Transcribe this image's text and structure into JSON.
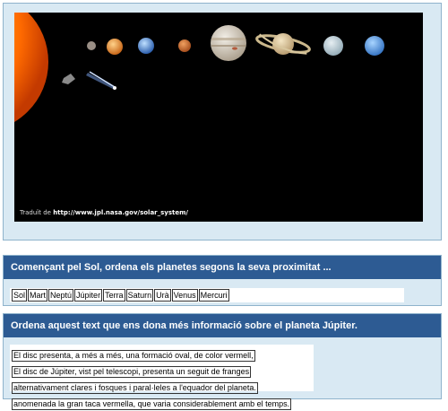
{
  "image": {
    "credit_prefix": "Traduït de",
    "credit_url": "http://www.jpl.nasa.gov/solar_system/"
  },
  "exercise1": {
    "instruction": "Començant pel Sol, ordena els planetes segons la seva proximitat ...",
    "chips": [
      "Sol",
      "Mart",
      "Neptú",
      "Júpiter",
      "Terra",
      "Saturn",
      "Urà",
      "Venus",
      "Mercuri"
    ]
  },
  "exercise2": {
    "instruction": "Ordena aquest text que ens dona més informació sobre el planeta Júpiter.",
    "sentences": [
      "El disc presenta, a més a més, una formació oval, de color vermell,",
      "El disc de Júpiter, vist pel telescopi, presenta un seguit de franges",
      "alternativament clares i fosques i paral·leles a l'equador del planeta.",
      "anomenada la gran taca vermella, que varia considerablement amb el temps."
    ]
  },
  "colors": {
    "header": "#2d5b93",
    "panel": "#d9e9f3",
    "border": "#8fb3cc"
  }
}
